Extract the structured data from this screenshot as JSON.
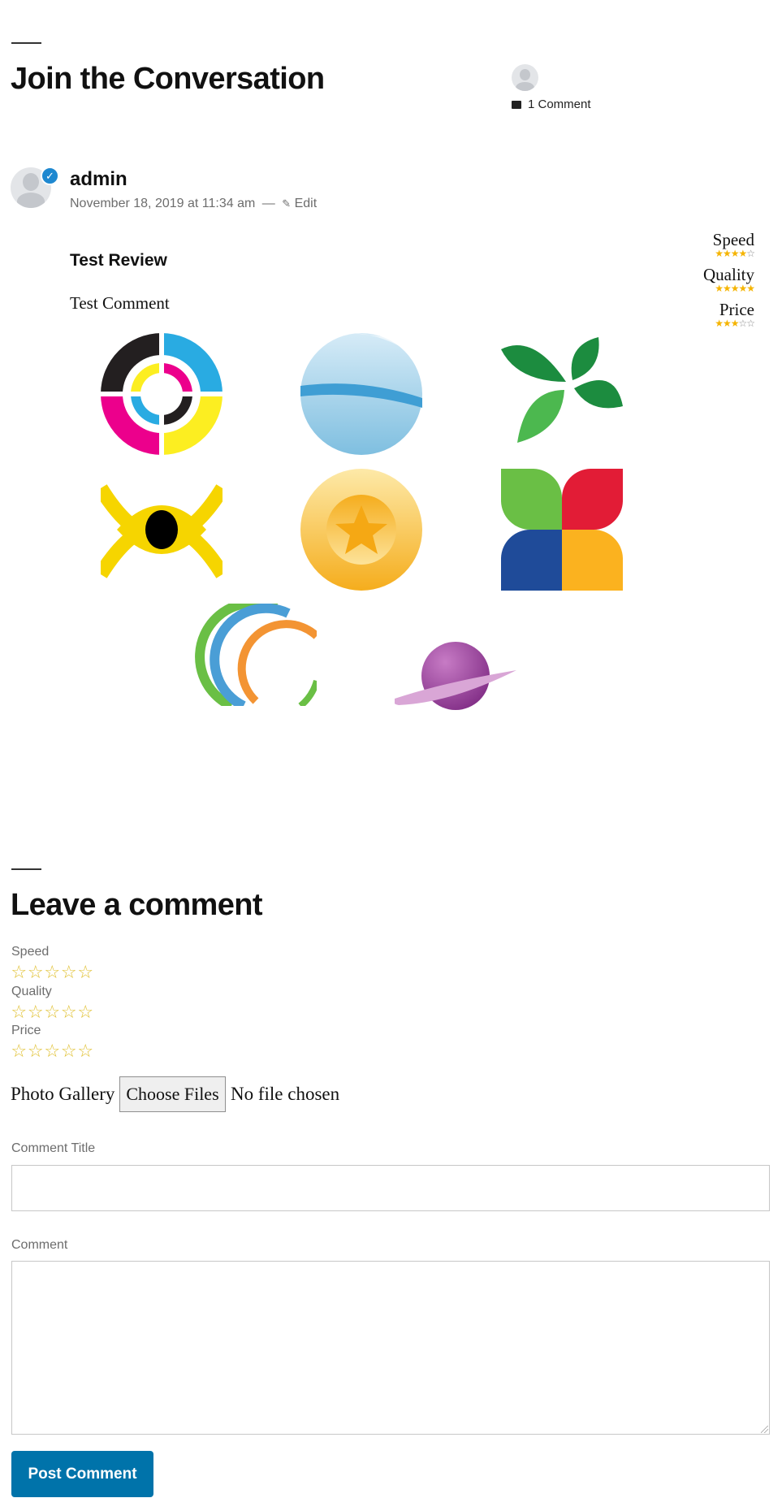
{
  "conversation": {
    "heading": "Join the Conversation",
    "comment_count": "1 Comment"
  },
  "comment": {
    "author": "admin",
    "date": "November 18, 2019 at 11:34 am",
    "separator": "—",
    "edit_label": "Edit",
    "title": "Test Review",
    "text": "Test Comment",
    "ratings": [
      {
        "label": "Speed",
        "stars": 4,
        "max": 5
      },
      {
        "label": "Quality",
        "stars": 5,
        "max": 5
      },
      {
        "label": "Price",
        "stars": 3,
        "max": 5
      }
    ],
    "gallery_icons": [
      "cmyk-target-logo",
      "blue-globe-logo",
      "green-leaves-logo",
      "yellow-eye-logo",
      "gold-star-coin-logo",
      "four-petal-logo",
      "arcs-logo",
      "planet-logo"
    ]
  },
  "form": {
    "heading": "Leave a comment",
    "rating_fields": [
      {
        "label": "Speed"
      },
      {
        "label": "Quality"
      },
      {
        "label": "Price"
      }
    ],
    "photo_label": "Photo Gallery",
    "choose_files_label": "Choose Files",
    "no_file_label": "No file chosen",
    "comment_title_label": "Comment Title",
    "comment_label": "Comment",
    "submit_label": "Post Comment"
  },
  "colors": {
    "accent": "#0073aa",
    "star": "#f5b400",
    "verified_badge": "#1e88d0"
  }
}
